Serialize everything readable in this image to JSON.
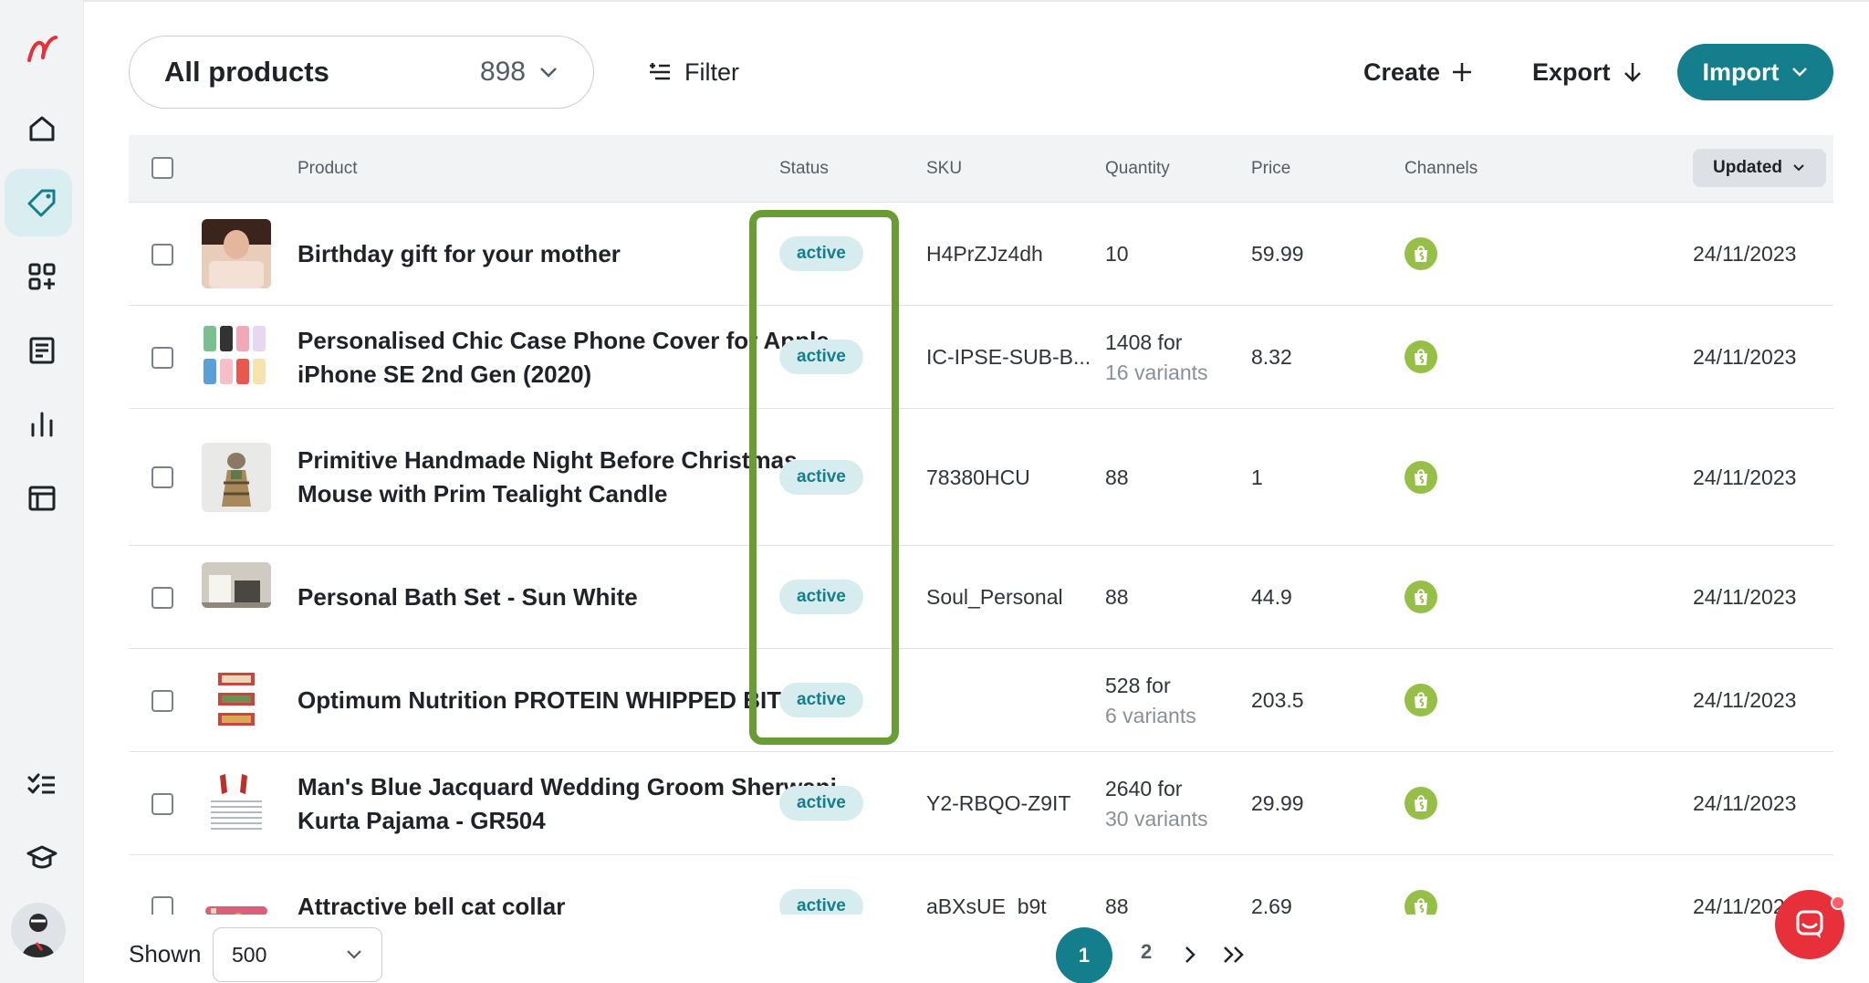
{
  "sidebar": {
    "items": [
      {
        "name": "home-icon"
      },
      {
        "name": "products-tag-icon",
        "active": true
      },
      {
        "name": "apps-grid-icon"
      },
      {
        "name": "orders-list-icon"
      },
      {
        "name": "analytics-bars-icon"
      },
      {
        "name": "layout-panel-icon"
      },
      {
        "name": "tasks-checklist-icon"
      },
      {
        "name": "academy-cap-icon"
      }
    ]
  },
  "header": {
    "collection_title": "All products",
    "collection_count": "898",
    "filter_label": "Filter",
    "create_label": "Create",
    "export_label": "Export",
    "import_label": "Import"
  },
  "table": {
    "columns": {
      "product": "Product",
      "status": "Status",
      "sku": "SKU",
      "quantity": "Quantity",
      "price": "Price",
      "channels": "Channels",
      "updated": "Updated"
    },
    "rows": [
      {
        "name": "Birthday gift for your mother",
        "status": "active",
        "sku": "H4PrZJz4dh",
        "quantity": "10",
        "quantity_sub": "",
        "price": "59.99",
        "updated": "24/11/2023"
      },
      {
        "name": "Personalised Chic Case Phone Cover for Apple iPhone SE 2nd Gen (2020)",
        "status": "active",
        "sku": "IC-IPSE-SUB-B...",
        "quantity": "1408 for",
        "quantity_sub": "16 variants",
        "price": "8.32",
        "updated": "24/11/2023"
      },
      {
        "name": "Primitive Handmade Night Before Christmas Mouse with Prim Tealight Candle",
        "status": "active",
        "sku": "78380HCU",
        "quantity": "88",
        "quantity_sub": "",
        "price": "1",
        "updated": "24/11/2023"
      },
      {
        "name": "Personal Bath Set - Sun White",
        "status": "active",
        "sku": "Soul_Personal",
        "quantity": "88",
        "quantity_sub": "",
        "price": "44.9",
        "updated": "24/11/2023"
      },
      {
        "name": "Optimum Nutrition PROTEIN WHIPPED BITES",
        "status": "active",
        "sku": "",
        "quantity": "528 for",
        "quantity_sub": "6 variants",
        "price": "203.5",
        "updated": "24/11/2023"
      },
      {
        "name": "Man's Blue Jacquard Wedding Groom Sherwani Kurta Pajama - GR504",
        "status": "active",
        "sku": "Y2-RBQO-Z9IT",
        "quantity": "2640 for",
        "quantity_sub": "30 variants",
        "price": "29.99",
        "updated": "24/11/2023"
      },
      {
        "name": "Attractive bell cat collar",
        "status": "active",
        "sku": "aBXsUE_b9t",
        "quantity": "88",
        "quantity_sub": "",
        "price": "2.69",
        "updated": "24/11/2023"
      }
    ]
  },
  "footer": {
    "shown_label": "Shown",
    "shown_value": "500",
    "pages": [
      "1",
      "2"
    ],
    "current_page": "1"
  },
  "colors": {
    "accent": "#157e8c",
    "badge_bg": "#d7ecef",
    "highlight": "#6a9c35",
    "shopify": "#95bf47",
    "brand": "#e8303a"
  }
}
